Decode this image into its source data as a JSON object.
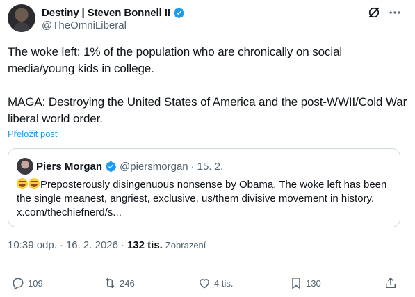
{
  "author": {
    "display_name": "Destiny | Steven Bonnell II",
    "handle": "@TheOmniLiberal",
    "verified": true
  },
  "tweet": {
    "text": "The woke left: 1% of the population who are chronically on social media/young kids in college.\n\nMAGA: Destroying the United States of America and the post-WWII/Cold War liberal world order.",
    "translate_label": "Přeložit post"
  },
  "quoted": {
    "display_name": "Piers Morgan",
    "handle": "@piersmorgan",
    "separator": "·",
    "date": "15. 2.",
    "text": "Preposterously disingenuous nonsense by Obama. The woke left has been the single meanest, angriest, exclusive, us/them divisive movement in history. x.com/thechiefnerd/s..."
  },
  "meta": {
    "time": "10:39 odp.",
    "date": "16. 2. 2026",
    "separator": "·",
    "views_count": "132 tis.",
    "views_label": "Zobrazení"
  },
  "actions": {
    "replies": "109",
    "reposts": "246",
    "likes": "4 tis.",
    "bookmarks": "130"
  },
  "icons": [
    "verified-icon",
    "grok-icon",
    "more-icon",
    "reply-icon",
    "repost-icon",
    "like-icon",
    "bookmark-icon",
    "share-icon"
  ],
  "colors": {
    "accent": "#1d9bf0",
    "text": "#0f1419",
    "secondary": "#536471",
    "border": "#cfd9de"
  }
}
